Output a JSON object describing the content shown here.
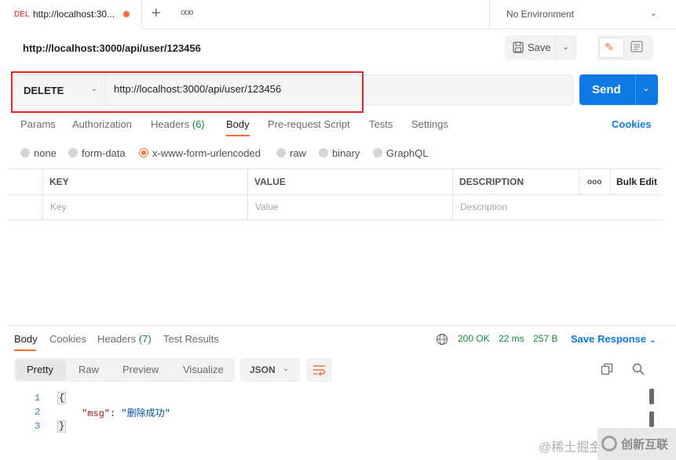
{
  "tabbar": {
    "tab": {
      "method": "DEL",
      "url": "http://localhost:30..."
    },
    "plus": "+",
    "more": "ooo",
    "environment": "No Environment"
  },
  "request": {
    "title": "http://localhost:3000/api/user/123456",
    "save_label": "Save",
    "method": "DELETE",
    "url": "http://localhost:3000/api/user/123456",
    "send_label": "Send",
    "tabs": [
      {
        "label": "Params"
      },
      {
        "label": "Authorization"
      },
      {
        "label": "Headers",
        "count": "(6)"
      },
      {
        "label": "Body"
      },
      {
        "label": "Pre-request Script"
      },
      {
        "label": "Tests"
      },
      {
        "label": "Settings"
      }
    ],
    "active_tab": "Body",
    "cookies_label": "Cookies",
    "body_types": [
      "none",
      "form-data",
      "x-www-form-urlencoded",
      "raw",
      "binary",
      "GraphQL"
    ],
    "selected_body_type": "x-www-form-urlencoded",
    "table": {
      "headers": {
        "key": "KEY",
        "value": "VALUE",
        "description": "DESCRIPTION",
        "more": "ooo",
        "bulk_edit": "Bulk Edit"
      },
      "placeholders": {
        "key": "Key",
        "value": "Value",
        "description": "Description"
      }
    }
  },
  "response": {
    "tabs": [
      {
        "label": "Body"
      },
      {
        "label": "Cookies"
      },
      {
        "label": "Headers",
        "count": "(7)"
      },
      {
        "label": "Test Results"
      }
    ],
    "active_tab": "Body",
    "status": "200 OK",
    "time": "22 ms",
    "size": "257 B",
    "save_response_label": "Save Response",
    "formats": [
      "Pretty",
      "Raw",
      "Preview",
      "Visualize"
    ],
    "active_format": "Pretty",
    "language": "JSON",
    "code": {
      "line_numbers": [
        "1",
        "2",
        "3"
      ],
      "open_brace": "{",
      "key": "\"msg\"",
      "colon": ": ",
      "value": "\"删除成功\"",
      "close_brace": "}"
    }
  },
  "watermark": {
    "left": "@稀土掘金",
    "right": "创新互联"
  },
  "colors": {
    "accent_orange": "#ff6c37",
    "send_blue": "#0f7ae5",
    "status_green": "#0f8a3c",
    "highlight_red": "#e0262b",
    "delete_method": "#eb2013"
  }
}
